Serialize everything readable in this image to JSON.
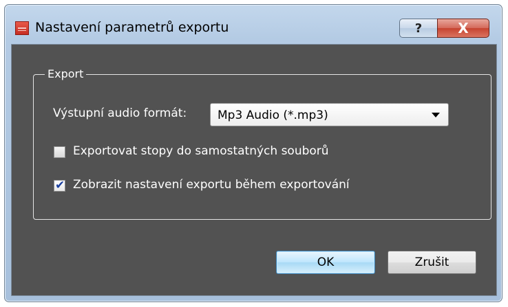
{
  "window": {
    "title": "Nastavení parametrů exportu",
    "help_glyph": "?",
    "close_glyph": "X"
  },
  "export_group": {
    "legend": "Export",
    "format_label": "Výstupní audio formát:",
    "format_value": "Mp3 Audio (*.mp3)",
    "options": [
      {
        "label": "Exportovat stopy do samostatných souborů",
        "checked": false
      },
      {
        "label": "Zobrazit nastavení exportu během exportování",
        "checked": true
      }
    ]
  },
  "buttons": {
    "ok": "OK",
    "cancel": "Zrušit"
  },
  "colors": {
    "client_bg": "#525252",
    "ok_border": "#3c7fb1",
    "close_red": "#c6432f"
  }
}
